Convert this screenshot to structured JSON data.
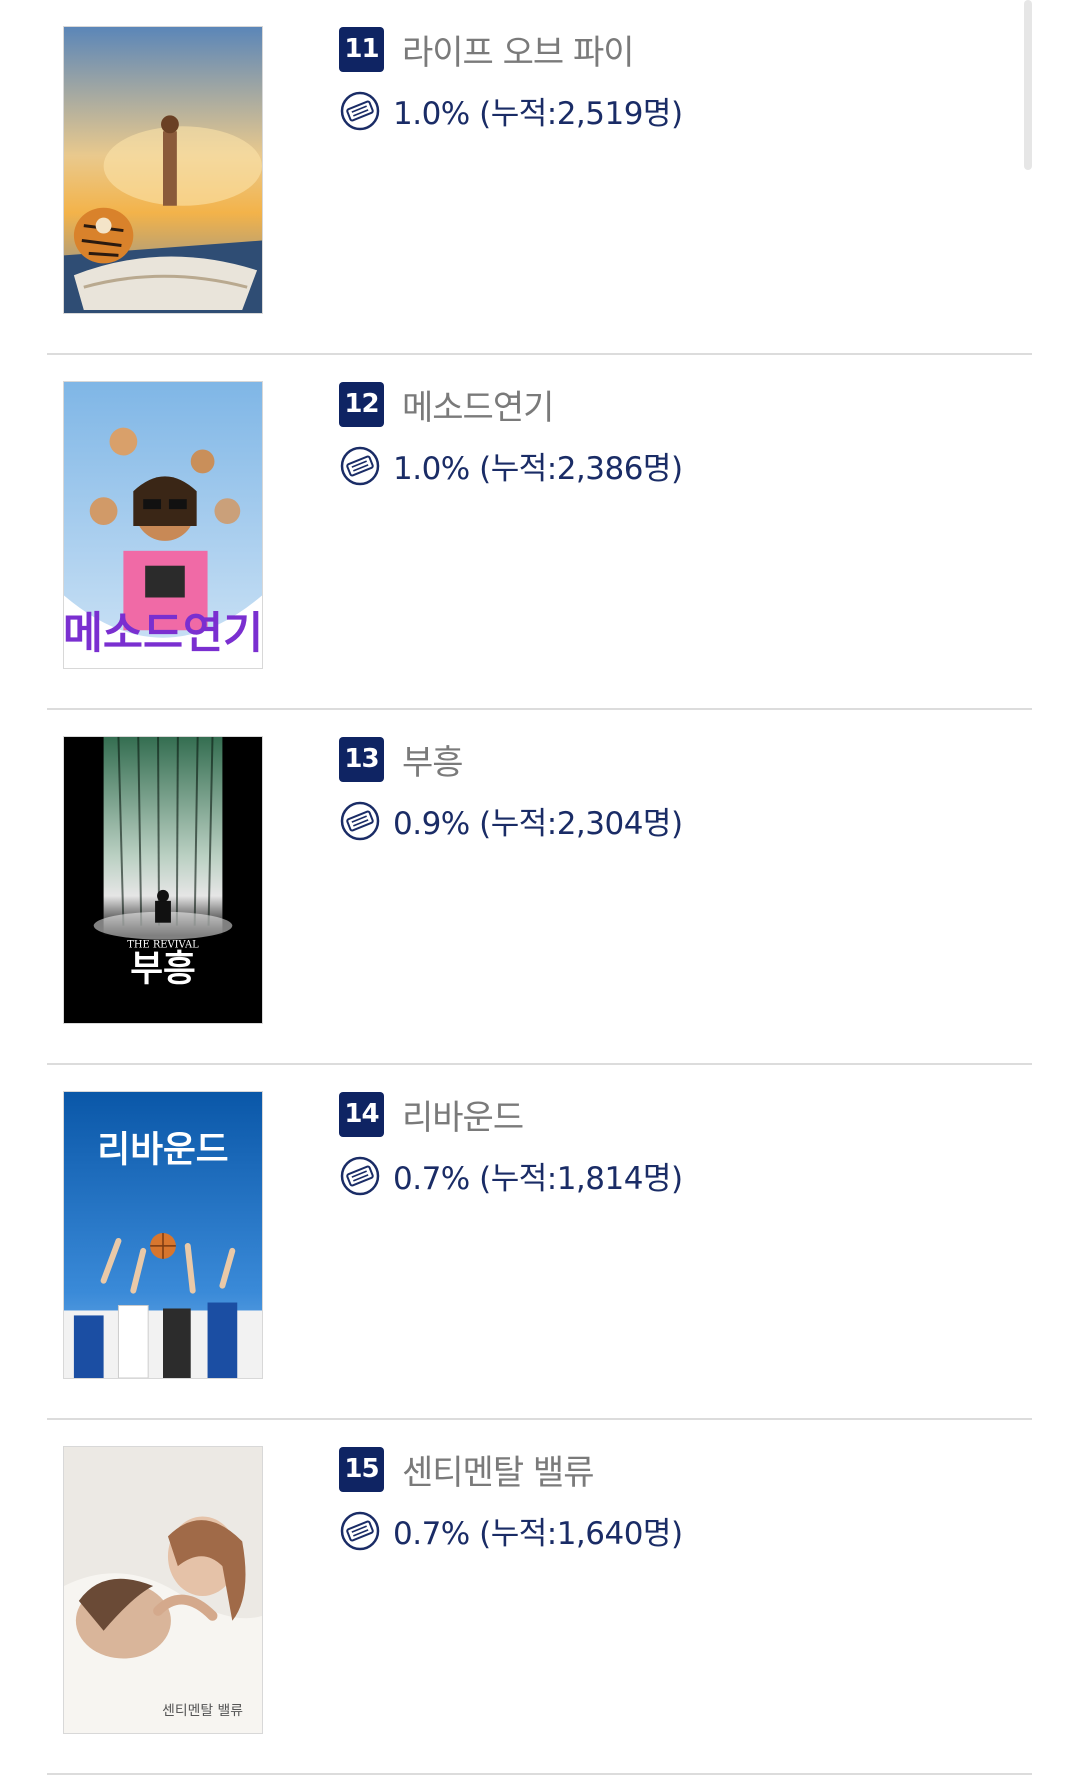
{
  "movies": [
    {
      "rank": "11",
      "title": "라이프 오브 파이",
      "stat": "1.0% (누적:2,519명)",
      "poster_icon": "poster-life-of-pi"
    },
    {
      "rank": "12",
      "title": "메소드연기",
      "stat": "1.0% (누적:2,386명)",
      "poster_icon": "poster-method-acting"
    },
    {
      "rank": "13",
      "title": "부흥",
      "stat": "0.9% (누적:2,304명)",
      "poster_icon": "poster-the-revival"
    },
    {
      "rank": "14",
      "title": "리바운드",
      "stat": "0.7% (누적:1,814명)",
      "poster_icon": "poster-rebound"
    },
    {
      "rank": "15",
      "title": "센티멘탈 밸류",
      "stat": "0.7% (누적:1,640명)",
      "poster_icon": "poster-sentimental-value"
    }
  ],
  "poster_texts": {
    "p12": "메소드연기",
    "p13_en": "THE REVIVAL",
    "p13": "부흥",
    "p14": "리바운드",
    "p15": "센티멘탈 밸류"
  },
  "colors": {
    "rank_badge": "#0f2463",
    "stat_text": "#1a2c66",
    "title_text": "#7a7a7a",
    "divider": "#dcdcdc"
  },
  "icons": {
    "stat": "ticket-icon"
  }
}
